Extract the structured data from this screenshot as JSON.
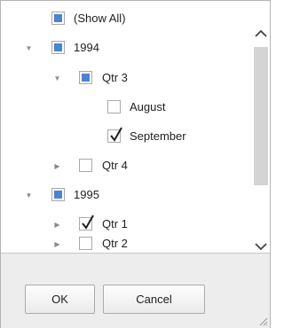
{
  "filter_popup": {
    "items": [
      {
        "label": "(Show All)",
        "state": "indeterminate",
        "expander": "none"
      },
      {
        "label": "1994",
        "state": "indeterminate",
        "expander": "expanded"
      },
      {
        "label": "Qtr 3",
        "state": "indeterminate",
        "expander": "expanded"
      },
      {
        "label": "August",
        "state": "unchecked",
        "expander": "none"
      },
      {
        "label": "September",
        "state": "checked",
        "expander": "none"
      },
      {
        "label": "Qtr 4",
        "state": "unchecked",
        "expander": "collapsed"
      },
      {
        "label": "1995",
        "state": "indeterminate",
        "expander": "expanded"
      },
      {
        "label": "Qtr 1",
        "state": "checked",
        "expander": "collapsed"
      },
      {
        "label": "Qtr 2",
        "state": "unchecked",
        "expander": "collapsed"
      }
    ],
    "ok_label": "OK",
    "cancel_label": "Cancel"
  },
  "colors": {
    "accent_fill": "#4a84d6",
    "checkbox_border": "#a9a9a9",
    "scroll_thumb": "#d4d4d4",
    "footer_bg": "#ededed"
  },
  "icons": {
    "expanded": "triangle-down-icon",
    "collapsed": "triangle-right-icon",
    "scroll_up": "chevron-up-icon",
    "scroll_down": "chevron-down-icon",
    "resize": "resize-grip-icon"
  }
}
